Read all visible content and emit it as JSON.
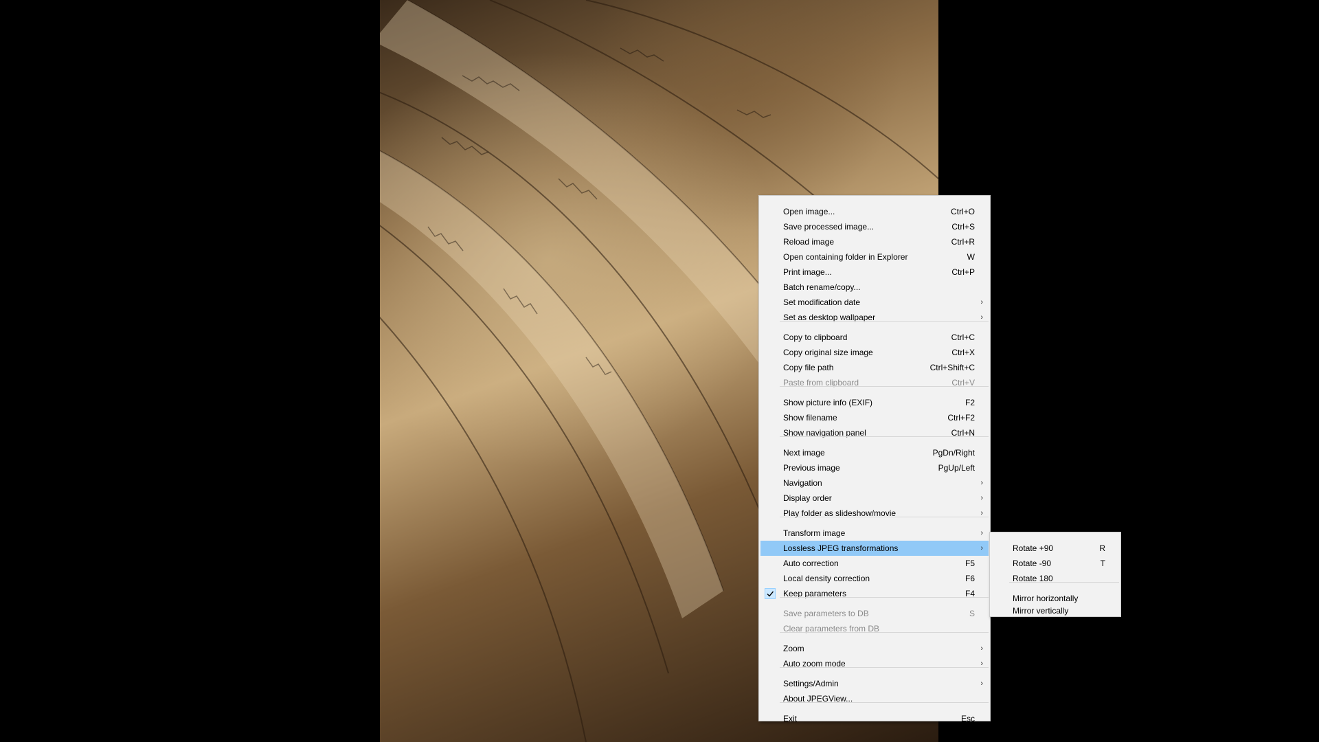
{
  "colors": {
    "highlight": "#91c9f7",
    "menu_bg": "#f2f2f2",
    "disabled": "#8a8a8a"
  },
  "photo": {
    "icon": "handwritten-pages-photo"
  },
  "menu": {
    "items": [
      {
        "label": "Open image...",
        "shortcut": "Ctrl+O"
      },
      {
        "label": "Save processed image...",
        "shortcut": "Ctrl+S"
      },
      {
        "label": "Reload image",
        "shortcut": "Ctrl+R"
      },
      {
        "label": "Open containing folder in Explorer",
        "shortcut": "W"
      },
      {
        "label": "Print image...",
        "shortcut": "Ctrl+P"
      },
      {
        "label": "Batch rename/copy...",
        "shortcut": ""
      },
      {
        "label": "Set modification date",
        "shortcut": ""
      },
      {
        "label": "Set as desktop wallpaper",
        "shortcut": ""
      },
      {
        "label": "Copy to clipboard",
        "shortcut": "Ctrl+C"
      },
      {
        "label": "Copy original size image",
        "shortcut": "Ctrl+X"
      },
      {
        "label": "Copy file path",
        "shortcut": "Ctrl+Shift+C"
      },
      {
        "label": "Paste from clipboard",
        "shortcut": "Ctrl+V"
      },
      {
        "label": "Show picture info (EXIF)",
        "shortcut": "F2"
      },
      {
        "label": "Show filename",
        "shortcut": "Ctrl+F2"
      },
      {
        "label": "Show navigation panel",
        "shortcut": "Ctrl+N"
      },
      {
        "label": "Next image",
        "shortcut": "PgDn/Right"
      },
      {
        "label": "Previous image",
        "shortcut": "PgUp/Left"
      },
      {
        "label": "Navigation",
        "shortcut": ""
      },
      {
        "label": "Display order",
        "shortcut": ""
      },
      {
        "label": "Play folder as slideshow/movie",
        "shortcut": ""
      },
      {
        "label": "Transform image",
        "shortcut": ""
      },
      {
        "label": "Lossless JPEG transformations",
        "shortcut": ""
      },
      {
        "label": "Auto correction",
        "shortcut": "F5"
      },
      {
        "label": "Local density correction",
        "shortcut": "F6"
      },
      {
        "label": "Keep parameters",
        "shortcut": "F4"
      },
      {
        "label": "Save parameters to DB",
        "shortcut": "S"
      },
      {
        "label": "Clear parameters from DB",
        "shortcut": ""
      },
      {
        "label": "Zoom",
        "shortcut": ""
      },
      {
        "label": "Auto zoom mode",
        "shortcut": ""
      },
      {
        "label": "Settings/Admin",
        "shortcut": ""
      },
      {
        "label": "About JPEGView...",
        "shortcut": ""
      },
      {
        "label": "Exit",
        "shortcut": "Esc"
      }
    ],
    "submenu_arrow": "›",
    "check_icon": "checkmark-icon",
    "keep_parameters_checked": true
  },
  "submenu": {
    "items": [
      {
        "label": "Rotate +90",
        "shortcut": "R"
      },
      {
        "label": "Rotate -90",
        "shortcut": "T"
      },
      {
        "label": "Rotate 180",
        "shortcut": ""
      },
      {
        "label": "Mirror horizontally",
        "shortcut": ""
      },
      {
        "label": "Mirror vertically",
        "shortcut": ""
      }
    ]
  }
}
